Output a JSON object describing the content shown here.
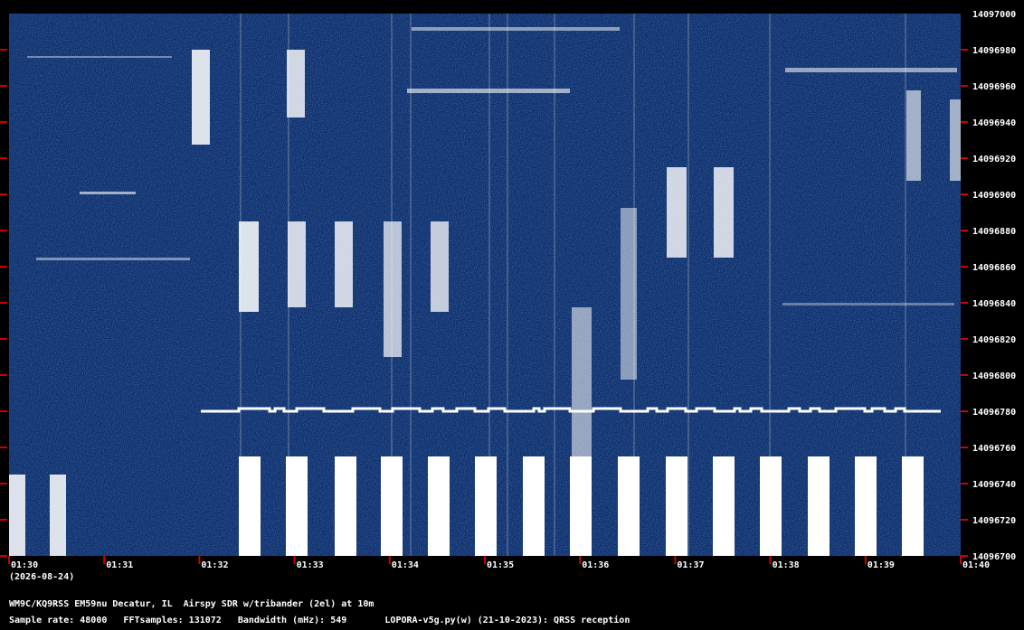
{
  "colors": {
    "background": "#000000",
    "waterfall": "#0d2f6b",
    "signal": "#ffffff",
    "tick": "#cc0000"
  },
  "chart_data": {
    "type": "heatmap",
    "xlabel": "",
    "ylabel": "",
    "x_ticks": [
      "01:30",
      "01:31",
      "01:32",
      "01:33",
      "01:34",
      "01:35",
      "01:36",
      "01:37",
      "01:38",
      "01:39",
      "01:40"
    ],
    "y_ticks": [
      14097000,
      14096980,
      14096960,
      14096940,
      14096920,
      14096900,
      14096880,
      14096860,
      14096840,
      14096820,
      14096800,
      14096780,
      14096760,
      14096740,
      14096720,
      14096700
    ],
    "y_range": [
      14096700,
      14097000
    ],
    "date_label": "(2026-08-24)"
  },
  "footer": {
    "station": "WM9C/KQ9RSS EM59nu Decatur, IL  Airspy SDR w/tribander (2el) at 10m",
    "info": "Sample rate: 48000   FFTsamples: 131072   Bandwidth (mHz): 549       LOPORA-v5g.py(w) (21-10-2023): QRSS reception"
  }
}
